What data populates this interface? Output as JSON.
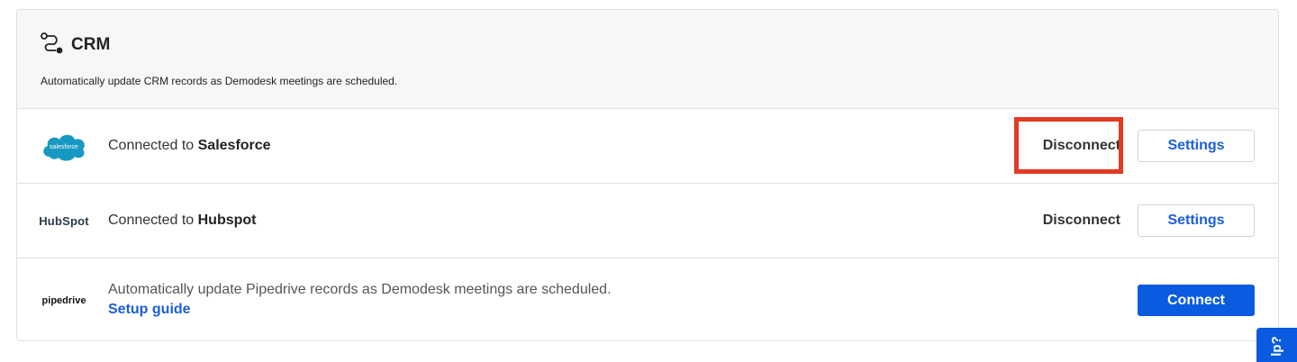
{
  "header": {
    "title": "CRM",
    "subtitle": "Automatically update CRM records as Demodesk meetings are scheduled."
  },
  "integrations": [
    {
      "logo_text": "salesforce",
      "prefix": "Connected to ",
      "name": "Salesforce",
      "disconnect_label": "Disconnect",
      "settings_label": "Settings",
      "highlighted": true
    },
    {
      "logo_text": "HubSpot",
      "prefix": "Connected to ",
      "name": "Hubspot",
      "disconnect_label": "Disconnect",
      "settings_label": "Settings"
    },
    {
      "logo_text": "pipedrive",
      "description": "Automatically update Pipedrive records as Demodesk meetings are scheduled.",
      "setup_link": "Setup guide",
      "connect_label": "Connect"
    }
  ],
  "help_tab": {
    "label": "lp?"
  },
  "colors": {
    "accent": "#0a5be0",
    "link": "#1a5fd8",
    "highlight": "#e23a24",
    "salesforce": "#1798c1",
    "hubspot_orange": "#ff5c35"
  },
  "icons": [
    "crm-route-icon",
    "salesforce-logo",
    "hubspot-logo",
    "pipedrive-logo"
  ]
}
